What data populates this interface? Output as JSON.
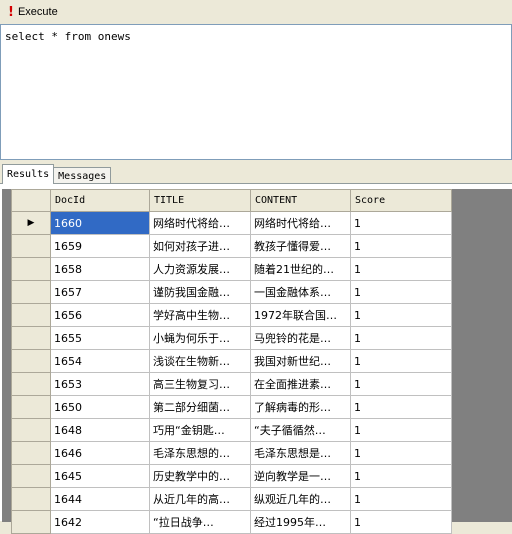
{
  "toolbar": {
    "execute_label": "Execute"
  },
  "editor": {
    "query": "select * from onews"
  },
  "tabs": [
    {
      "label": "Results",
      "active": true
    },
    {
      "label": "Messages",
      "active": false
    }
  ],
  "grid": {
    "columns": [
      "DocId",
      "TITLE",
      "CONTENT",
      "Score"
    ],
    "current_row_marker": "▶",
    "rows": [
      [
        "1660",
        "网络时代将给…",
        "网络时代将给…",
        "1"
      ],
      [
        "1659",
        "如何对孩子进…",
        "教孩子懂得爱…",
        "1"
      ],
      [
        "1658",
        "人力资源发展…",
        "随着21世纪的…",
        "1"
      ],
      [
        "1657",
        "谨防我国金融…",
        "一国金融体系…",
        "1"
      ],
      [
        "1656",
        "学好高中生物…",
        "1972年联合国…",
        "1"
      ],
      [
        "1655",
        "小蝇为何乐于…",
        "马兜铃的花是…",
        "1"
      ],
      [
        "1654",
        "浅谈在生物新…",
        "我国对新世纪…",
        "1"
      ],
      [
        "1653",
        "高三生物复习…",
        "在全面推进素…",
        "1"
      ],
      [
        "1650",
        "第二部分细菌…",
        "了解病毒的形…",
        "1"
      ],
      [
        "1648",
        "巧用“金钥匙…",
        "“夫子循循然…",
        "1"
      ],
      [
        "1646",
        "毛泽东思想的…",
        "毛泽东思想是…",
        "1"
      ],
      [
        "1645",
        "历史教学中的…",
        "逆向教学是一…",
        "1"
      ],
      [
        "1644",
        "从近几年的高…",
        "纵观近几年的…",
        "1"
      ],
      [
        "1642",
        "“拉日战争…",
        "经过1995年…",
        "1"
      ]
    ]
  }
}
